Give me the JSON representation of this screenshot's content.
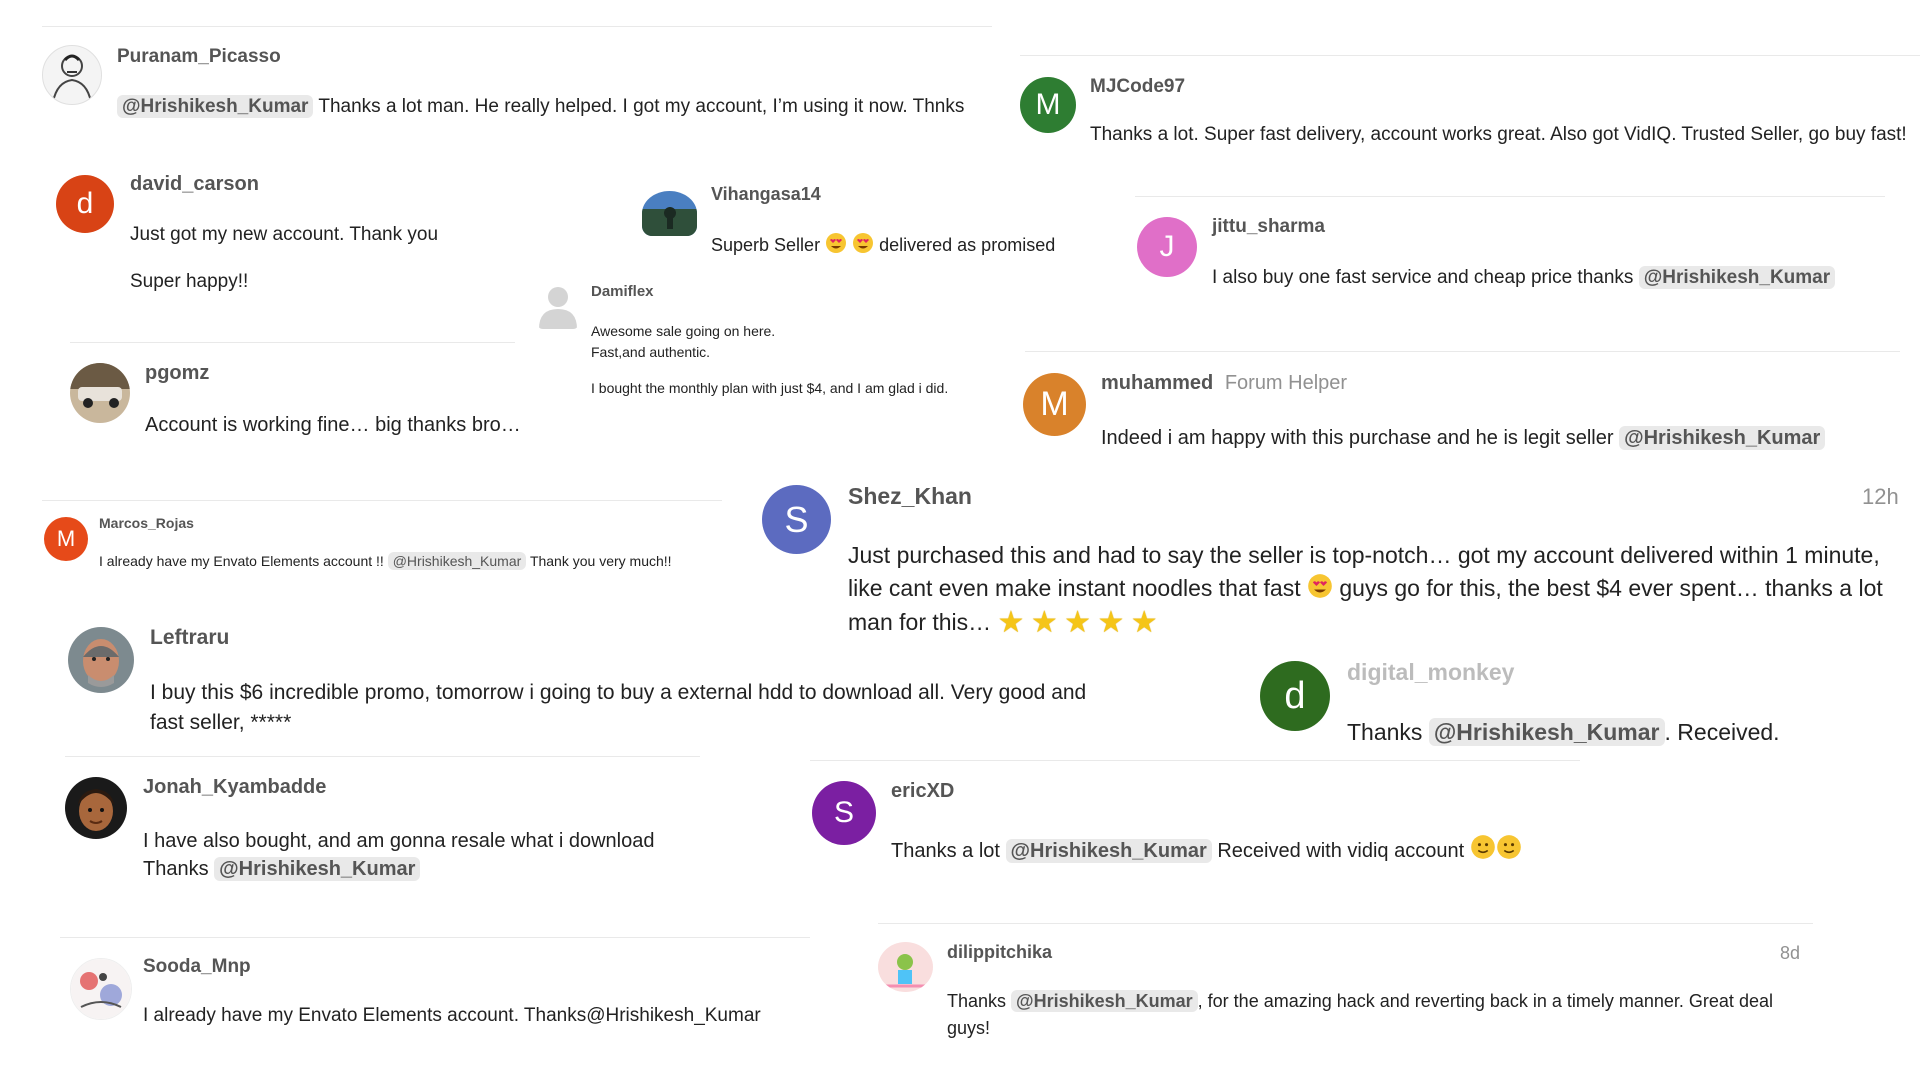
{
  "colors": {
    "mention_bg": "#e9e9e9",
    "username": "#555555",
    "muted": "#919191",
    "avatar_m_green": "#2e7d32",
    "avatar_d_red": "#d84315",
    "avatar_j_pink": "#e06fc8",
    "avatar_m_orange": "#d9822b",
    "avatar_s_blue": "#5c6bc0",
    "avatar_m_red": "#e64a19",
    "avatar_d_darkgreen": "#2e6b1f",
    "avatar_s_purple": "#7b1fa2"
  },
  "posts": {
    "puranam": {
      "username": "Puranam_Picasso",
      "avatar_icon": "sketch-portrait-icon",
      "mention": "@Hrishikesh_Kumar",
      "text": "Thanks a lot man. He really helped. I got my account, I’m using it now. Thnks"
    },
    "mjcode": {
      "username": "MJCode97",
      "avatar_letter": "M",
      "text": "Thanks a lot. Super fast delivery, account works great. Also got VidIQ. Trusted Seller, go buy fast!"
    },
    "david": {
      "username": "david_carson",
      "avatar_letter": "d",
      "line1": "Just got my new account. Thank you",
      "line2": "Super happy!!"
    },
    "vihangasa": {
      "username": "Vihangasa14",
      "avatar_icon": "landscape-photo-icon",
      "text_before": "Superb Seller",
      "text_after": "delivered as promised"
    },
    "jittu": {
      "username": "jittu_sharma",
      "avatar_letter": "J",
      "text": "I also buy one fast service and cheap price thanks",
      "mention": "@Hrishikesh_Kumar"
    },
    "damiflex": {
      "username": "Damiflex",
      "avatar_icon": "default-user-icon",
      "line1": "Awesome sale going on here.",
      "line2": "Fast,and authentic.",
      "line3": "I bought the monthly plan with just $4, and I am glad i did."
    },
    "pgomz": {
      "username": "pgomz",
      "avatar_icon": "photo-avatar-icon",
      "text": "Account is working fine… big thanks bro…"
    },
    "muhammed": {
      "username": "muhammed",
      "title": "Forum Helper",
      "avatar_letter": "M",
      "text": "Indeed i am happy with this purchase and he is legit seller",
      "mention": "@Hrishikesh_Kumar"
    },
    "marcos": {
      "username": "Marcos_Rojas",
      "avatar_letter": "M",
      "text_before": "I already have my Envato Elements account !!",
      "mention": "@Hrishikesh_Kumar",
      "text_after": "Thank you very much!!"
    },
    "shez": {
      "username": "Shez_Khan",
      "avatar_letter": "S",
      "time": "12h",
      "line1": "Just purchased this and had to say the seller is top-notch… got my account delivered within 1 minute,",
      "line2_before": "like cant even make instant noodles that fast",
      "line2_after": "guys go for this, the best $4 ever spent… thanks a lot",
      "line3": "man for this…"
    },
    "leftraru": {
      "username": "Leftraru",
      "avatar_icon": "face-photo-icon",
      "line1": "I buy this $6 incredible promo, tomorrow i going to buy a external hdd to download all. Very good and",
      "line2": "fast seller, *****"
    },
    "digital": {
      "username": "digital_monkey",
      "avatar_letter": "d",
      "text_before": "Thanks",
      "mention": "@Hrishikesh_Kumar",
      "text_after": ". Received."
    },
    "jonah": {
      "username": "Jonah_Kyambadde",
      "avatar_icon": "cartoon-face-icon",
      "line1": "I have also bought, and am gonna resale what i download",
      "line2_before": "Thanks",
      "mention": "@Hrishikesh_Kumar"
    },
    "eric": {
      "username": "ericXD",
      "avatar_letter": "S",
      "text_before": "Thanks a lot",
      "mention": "@Hrishikesh_Kumar",
      "text_after": "Received with vidiq account"
    },
    "sooda": {
      "username": "Sooda_Mnp",
      "avatar_icon": "illustration-avatar-icon",
      "text": "I already have my Envato Elements account. Thanks@Hrishikesh_Kumar"
    },
    "dilip": {
      "username": "dilippitchika",
      "avatar_icon": "illustration-avatar-icon",
      "time": "8d",
      "text_before": "Thanks",
      "mention": "@Hrishikesh_Kumar",
      "text_after": ", for the amazing hack and reverting back in a timely manner. Great deal",
      "line2": "guys!"
    }
  }
}
